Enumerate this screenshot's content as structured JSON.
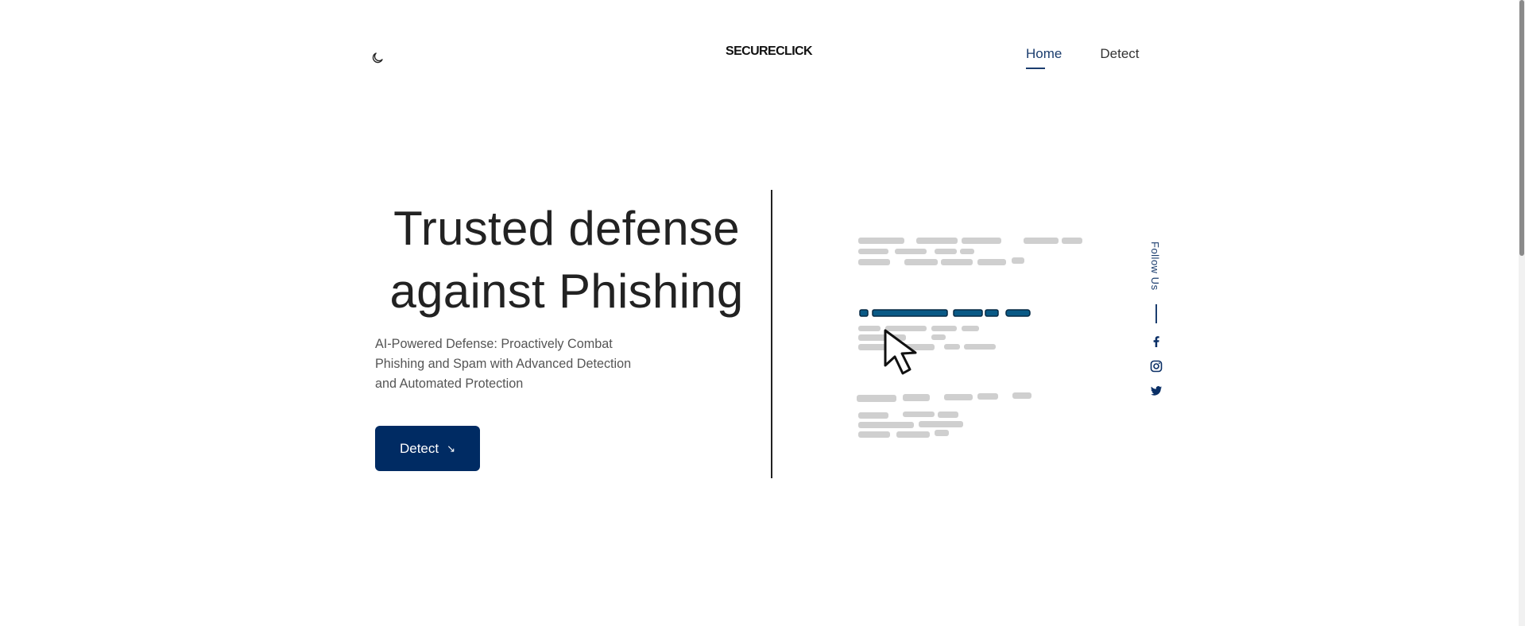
{
  "header": {
    "brand": "SECURECLICK",
    "theme_icon": "moon-icon",
    "nav": [
      {
        "label": "Home",
        "active": true
      },
      {
        "label": "Detect",
        "active": false
      }
    ]
  },
  "hero": {
    "title_line1": "Trusted defense",
    "title_line2": "against Phishing",
    "subtitle_line1": "AI-Powered Defense: Proactively Combat",
    "subtitle_line2": "Phishing and Spam with Advanced Detection",
    "subtitle_line3": "and Automated Protection",
    "cta_label": "Detect",
    "cta_icon": "arrow-down-right-icon"
  },
  "illustration": {
    "icon": "email-link-cursor-illustration",
    "highlight_color": "#0a5a86",
    "placeholder_color": "#cfcfcf"
  },
  "social": {
    "label": "Follow Us",
    "icons": [
      "facebook-icon",
      "instagram-icon",
      "twitter-icon"
    ]
  },
  "colors": {
    "accent": "#002b63",
    "link_active": "#1b3d6e"
  }
}
